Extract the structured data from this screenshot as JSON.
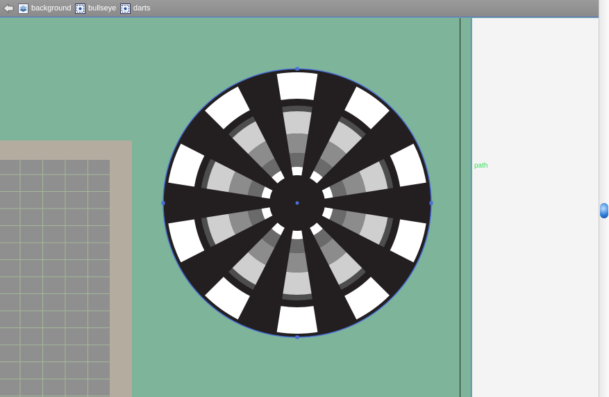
{
  "breadcrumbs": [
    {
      "label": "background",
      "icon": "layer-stack-icon"
    },
    {
      "label": "bullseye",
      "icon": "symbol-icon"
    },
    {
      "label": "darts",
      "icon": "symbol-icon"
    }
  ],
  "panel": {
    "selection_label": "path"
  },
  "colors": {
    "canvas": "#7db49a",
    "board_dark": "#231f20",
    "board_light": "#ffffff",
    "selection": "#4a6fd8",
    "path_label": "#33e05a"
  }
}
